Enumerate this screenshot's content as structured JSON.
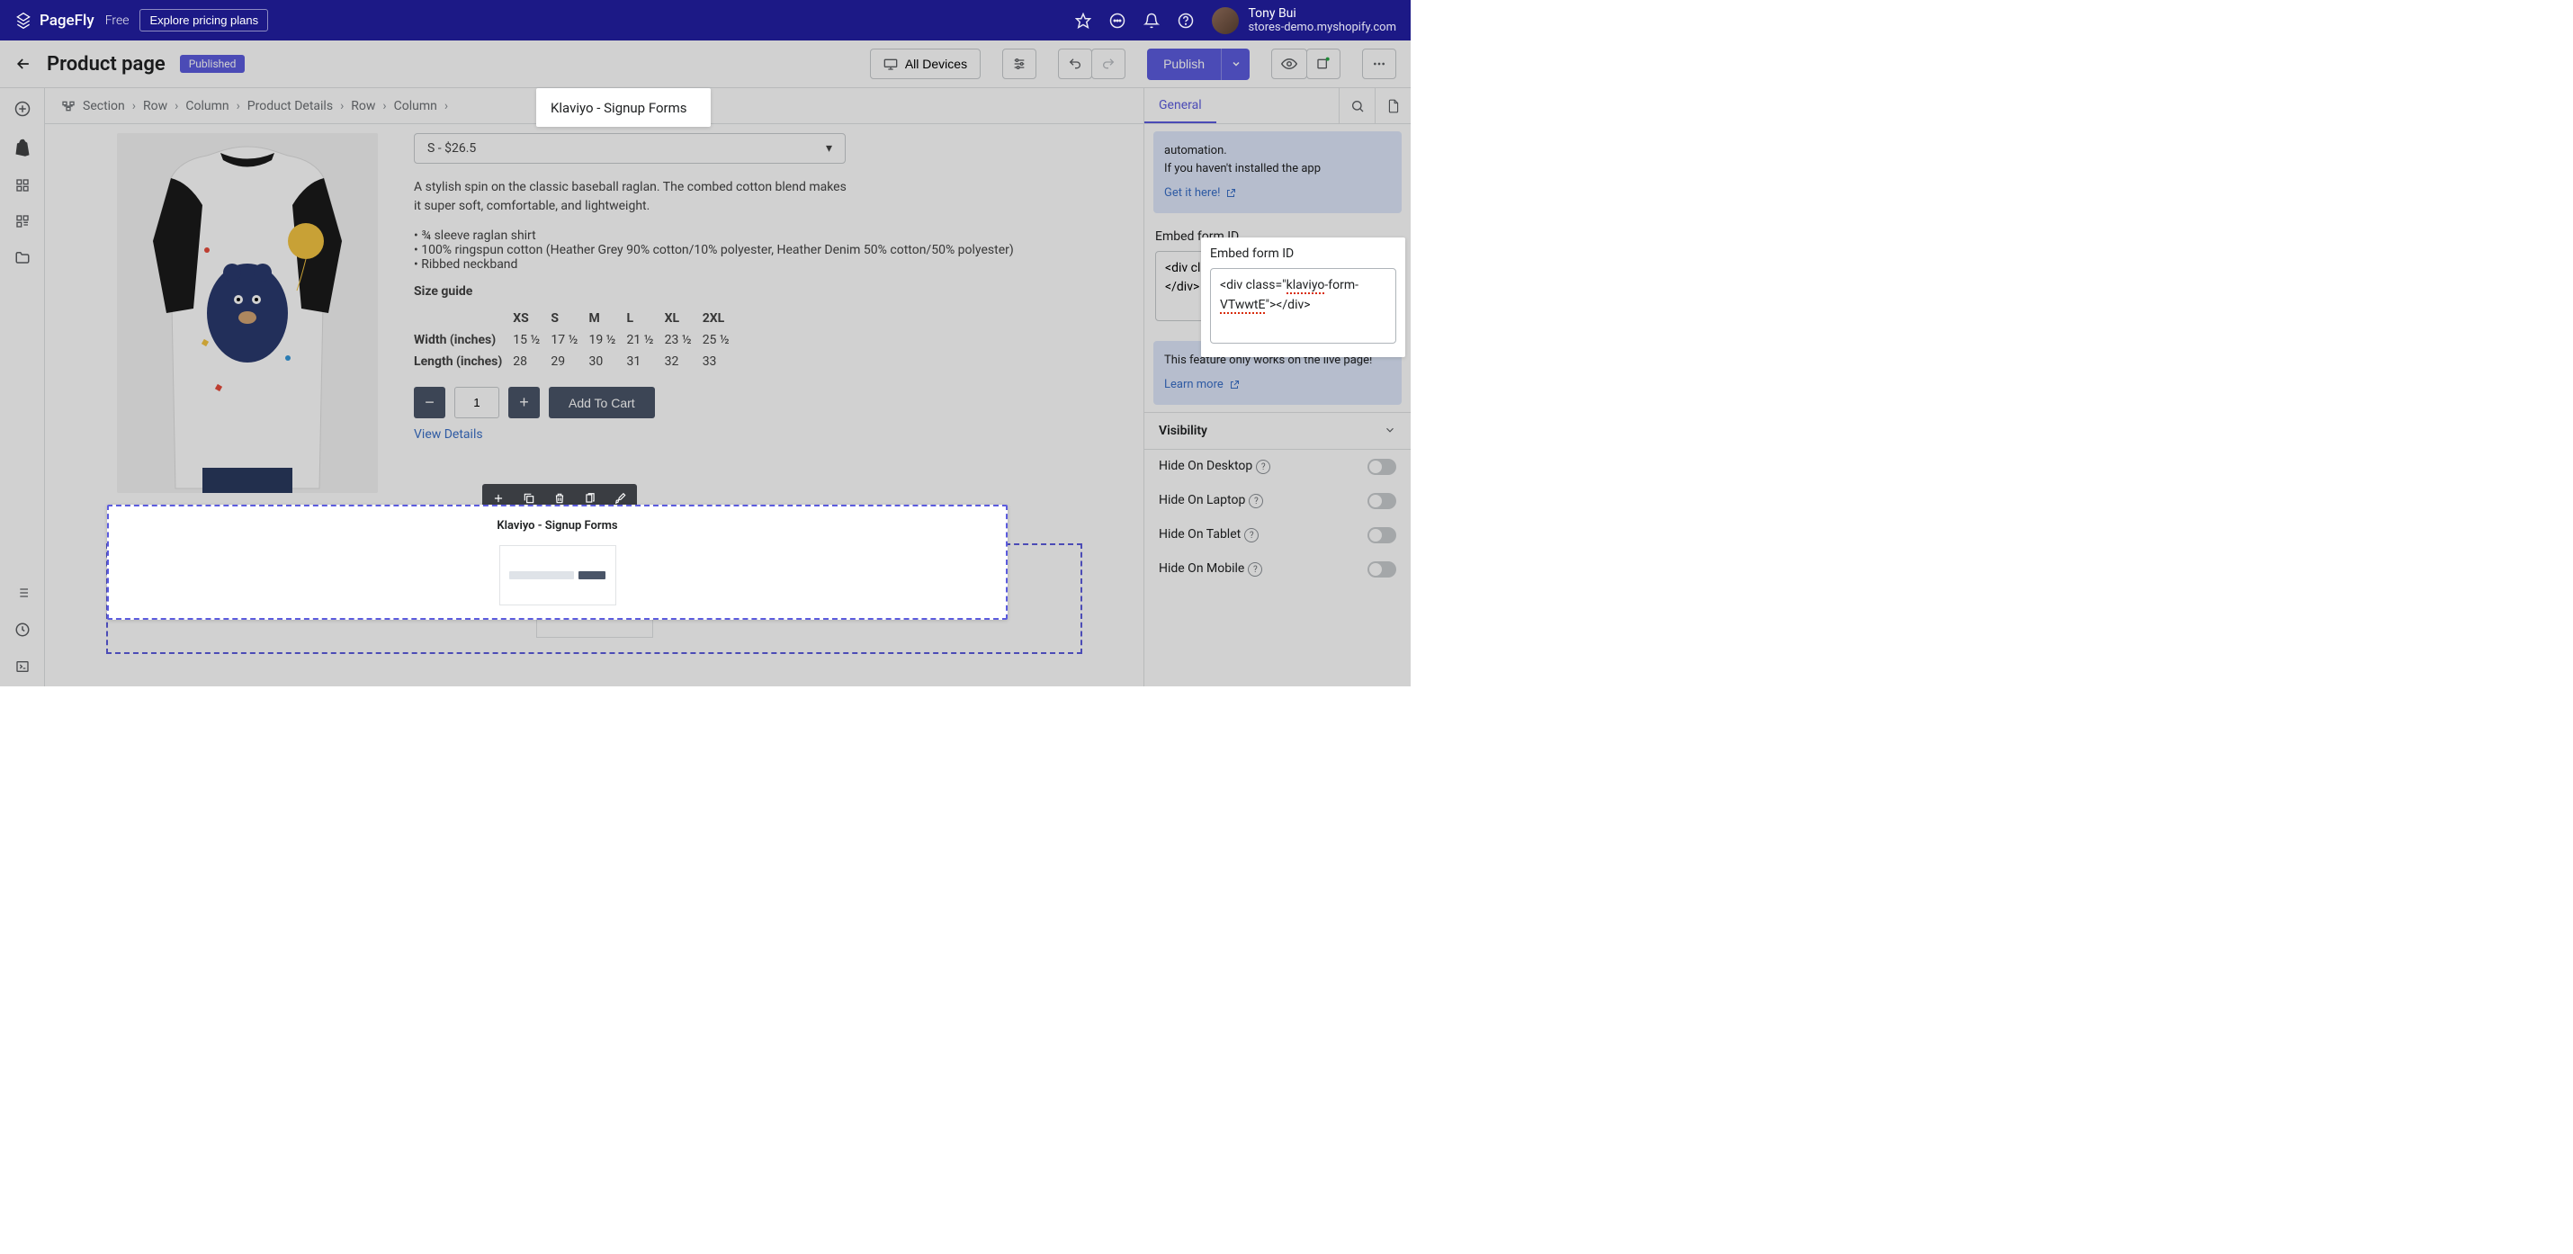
{
  "topbar": {
    "brand": "PageFly",
    "plan": "Free",
    "pricing_btn": "Explore pricing plans",
    "user_name": "Tony Bui",
    "store": "stores-demo.myshopify.com"
  },
  "header": {
    "page_title": "Product page",
    "status_badge": "Published",
    "all_devices": "All Devices",
    "publish": "Publish"
  },
  "breadcrumb": [
    "Section",
    "Row",
    "Column",
    "Product Details",
    "Row",
    "Column",
    "Klaviyo - Signup Forms"
  ],
  "product": {
    "variant": "S - $26.5",
    "description": "A stylish spin on the classic baseball raglan. The combed cotton blend makes it super soft, comfortable, and lightweight.",
    "bullets": [
      "¾ sleeve raglan shirt",
      "100% ringspun cotton (Heather Grey 90% cotton/10% polyester, Heather Denim 50% cotton/50% polyester)",
      "Ribbed neckband"
    ],
    "size_guide_label": "Size guide",
    "size_headers": [
      "",
      "XS",
      "S",
      "M",
      "L",
      "XL",
      "2XL"
    ],
    "size_rows": [
      {
        "label": "Width (inches)",
        "vals": [
          "15 ½",
          "17 ½",
          "19 ½",
          "21 ½",
          "23 ½",
          "25 ½"
        ]
      },
      {
        "label": "Length (inches)",
        "vals": [
          "28",
          "29",
          "30",
          "31",
          "32",
          "33"
        ]
      }
    ],
    "qty": "1",
    "add_to_cart": "Add To Cart",
    "view_details": "View Details"
  },
  "klaviyo_block": {
    "title": "Klaviyo - Signup Forms"
  },
  "rightpanel": {
    "tab_general": "General",
    "info1_line1": "automation.",
    "info1_line2": "If you haven't installed the app",
    "info1_link": "Get it here!",
    "embed_label": "Embed form ID",
    "embed_value": "<div class=\"klaviyo-form-VTwwtE\"></div>",
    "info2_text": "This feature only works on the live page!",
    "info2_link": "Learn more",
    "visibility_heading": "Visibility",
    "vis_rows": [
      "Hide On Desktop",
      "Hide On Laptop",
      "Hide On Tablet",
      "Hide On Mobile"
    ]
  }
}
